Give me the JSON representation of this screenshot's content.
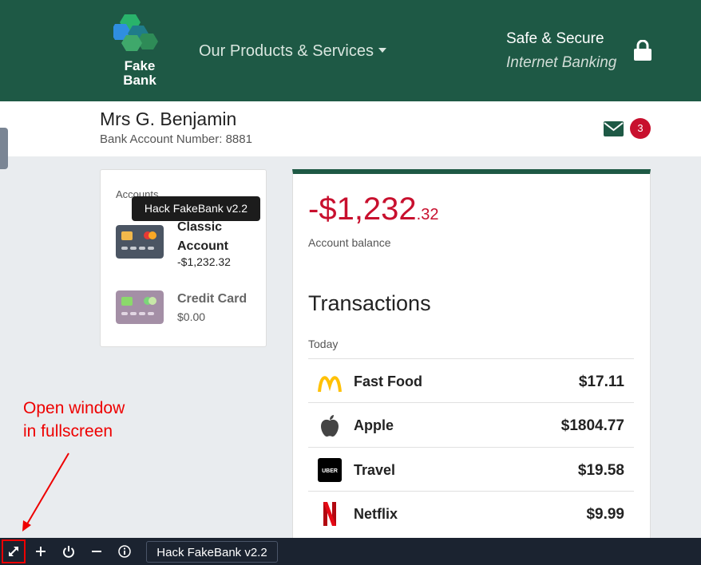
{
  "header": {
    "logo_line1": "Fake",
    "logo_line2": "Bank",
    "products_menu": "Our Products & Services",
    "safe_secure": "Safe & Secure",
    "internet_banking": "Internet Banking"
  },
  "user": {
    "name": "Mrs G. Benjamin",
    "account_number": "Bank Account Number: 8881",
    "unread_messages": "3"
  },
  "accounts": {
    "label": "Accounts",
    "items": [
      {
        "name": "Classic Account",
        "balance": "-$1,232.32"
      },
      {
        "name": "Credit Card",
        "balance": "$0.00"
      }
    ]
  },
  "tooltip": "Hack FakeBank v2.2",
  "balance": {
    "whole": "-$1,232",
    "cents": ".32",
    "label": "Account balance"
  },
  "transactions": {
    "title": "Transactions",
    "group": "Today",
    "items": [
      {
        "name": "Fast Food",
        "amount": "$17.11",
        "icon": "mcdonalds-icon"
      },
      {
        "name": "Apple",
        "amount": "$1804.77",
        "icon": "apple-icon"
      },
      {
        "name": "Travel",
        "amount": "$19.58",
        "icon": "uber-icon"
      },
      {
        "name": "Netflix",
        "amount": "$9.99",
        "icon": "netflix-icon"
      }
    ]
  },
  "annotation": {
    "line1": "Open window",
    "line2": "in fullscreen"
  },
  "taskbar": {
    "window_title": "Hack FakeBank v2.2"
  },
  "colors": {
    "brand_green": "#1e5945",
    "negative_red": "#c8102e",
    "annotation_red": "#ee0000"
  }
}
